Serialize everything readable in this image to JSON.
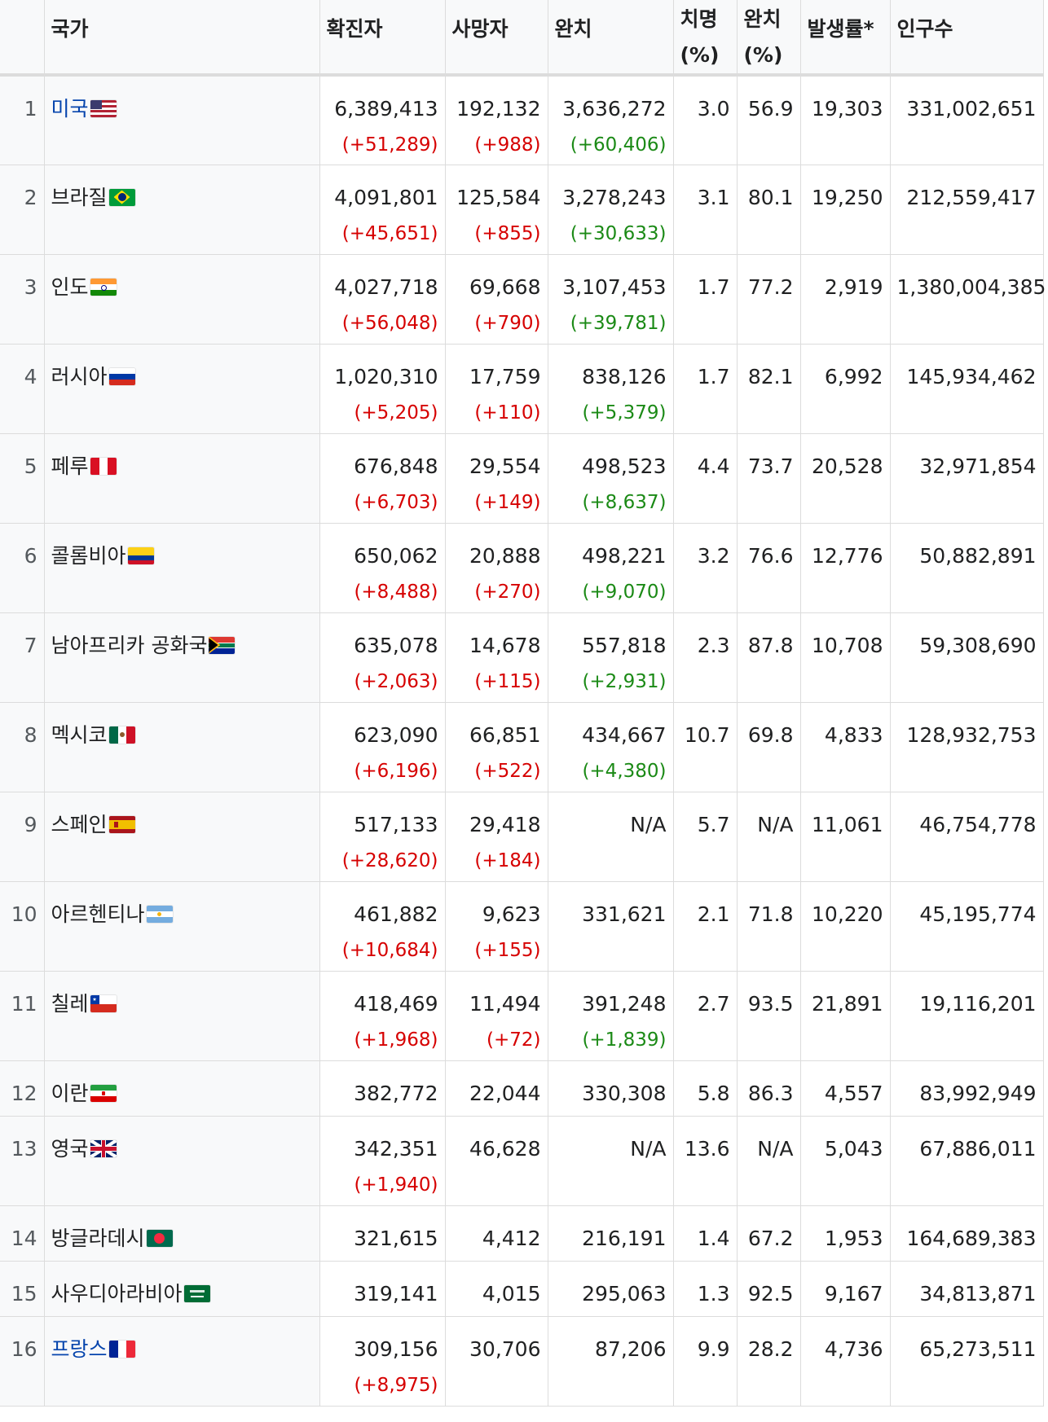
{
  "headers": {
    "country": "국가",
    "confirmed": "확진자",
    "deaths": "사망자",
    "recovered": "완치",
    "cfr_line1": "치명",
    "cfr_line2": "(%)",
    "rec_line1": "완치",
    "rec_line2": "(%)",
    "incidence": "발생률*",
    "population": "인구수"
  },
  "rows": [
    {
      "rank": "1",
      "country": "미국",
      "link": true,
      "flag": "us-flag",
      "confirmed": "6,389,413",
      "confirmed_delta": "(+51,289)",
      "deaths": "192,132",
      "deaths_delta": "(+988)",
      "recovered": "3,636,272",
      "recovered_delta": "(+60,406)",
      "cfr": "3.0",
      "rec_pct": "56.9",
      "incidence": "19,303",
      "population": "331,002,651"
    },
    {
      "rank": "2",
      "country": "브라질",
      "link": false,
      "flag": "br-flag",
      "confirmed": "4,091,801",
      "confirmed_delta": "(+45,651)",
      "deaths": "125,584",
      "deaths_delta": "(+855)",
      "recovered": "3,278,243",
      "recovered_delta": "(+30,633)",
      "cfr": "3.1",
      "rec_pct": "80.1",
      "incidence": "19,250",
      "population": "212,559,417"
    },
    {
      "rank": "3",
      "country": "인도",
      "link": false,
      "flag": "in-flag",
      "confirmed": "4,027,718",
      "confirmed_delta": "(+56,048)",
      "deaths": "69,668",
      "deaths_delta": "(+790)",
      "recovered": "3,107,453",
      "recovered_delta": "(+39,781)",
      "cfr": "1.7",
      "rec_pct": "77.2",
      "incidence": "2,919",
      "population": "1,380,004,385"
    },
    {
      "rank": "4",
      "country": "러시아",
      "link": false,
      "flag": "ru-flag",
      "confirmed": "1,020,310",
      "confirmed_delta": "(+5,205)",
      "deaths": "17,759",
      "deaths_delta": "(+110)",
      "recovered": "838,126",
      "recovered_delta": "(+5,379)",
      "cfr": "1.7",
      "rec_pct": "82.1",
      "incidence": "6,992",
      "population": "145,934,462"
    },
    {
      "rank": "5",
      "country": "페루",
      "link": false,
      "flag": "pe-flag",
      "confirmed": "676,848",
      "confirmed_delta": "(+6,703)",
      "deaths": "29,554",
      "deaths_delta": "(+149)",
      "recovered": "498,523",
      "recovered_delta": "(+8,637)",
      "cfr": "4.4",
      "rec_pct": "73.7",
      "incidence": "20,528",
      "population": "32,971,854"
    },
    {
      "rank": "6",
      "country": "콜롬비아",
      "link": false,
      "flag": "co-flag",
      "confirmed": "650,062",
      "confirmed_delta": "(+8,488)",
      "deaths": "20,888",
      "deaths_delta": "(+270)",
      "recovered": "498,221",
      "recovered_delta": "(+9,070)",
      "cfr": "3.2",
      "rec_pct": "76.6",
      "incidence": "12,776",
      "population": "50,882,891"
    },
    {
      "rank": "7",
      "country": "남아프리카 공화국",
      "link": false,
      "flag": "za-flag",
      "confirmed": "635,078",
      "confirmed_delta": "(+2,063)",
      "deaths": "14,678",
      "deaths_delta": "(+115)",
      "recovered": "557,818",
      "recovered_delta": "(+2,931)",
      "cfr": "2.3",
      "rec_pct": "87.8",
      "incidence": "10,708",
      "population": "59,308,690"
    },
    {
      "rank": "8",
      "country": "멕시코",
      "link": false,
      "flag": "mx-flag",
      "confirmed": "623,090",
      "confirmed_delta": "(+6,196)",
      "deaths": "66,851",
      "deaths_delta": "(+522)",
      "recovered": "434,667",
      "recovered_delta": "(+4,380)",
      "cfr": "10.7",
      "rec_pct": "69.8",
      "incidence": "4,833",
      "population": "128,932,753"
    },
    {
      "rank": "9",
      "country": "스페인",
      "link": false,
      "flag": "es-flag",
      "confirmed": "517,133",
      "confirmed_delta": "(+28,620)",
      "deaths": "29,418",
      "deaths_delta": "(+184)",
      "recovered": "N/A",
      "recovered_delta": "",
      "cfr": "5.7",
      "rec_pct": "N/A",
      "incidence": "11,061",
      "population": "46,754,778"
    },
    {
      "rank": "10",
      "country": "아르헨티나",
      "link": false,
      "flag": "ar-flag",
      "confirmed": "461,882",
      "confirmed_delta": "(+10,684)",
      "deaths": "9,623",
      "deaths_delta": "(+155)",
      "recovered": "331,621",
      "recovered_delta": "",
      "cfr": "2.1",
      "rec_pct": "71.8",
      "incidence": "10,220",
      "population": "45,195,774"
    },
    {
      "rank": "11",
      "country": "칠레",
      "link": false,
      "flag": "cl-flag",
      "confirmed": "418,469",
      "confirmed_delta": "(+1,968)",
      "deaths": "11,494",
      "deaths_delta": "(+72)",
      "recovered": "391,248",
      "recovered_delta": "(+1,839)",
      "cfr": "2.7",
      "rec_pct": "93.5",
      "incidence": "21,891",
      "population": "19,116,201"
    },
    {
      "rank": "12",
      "country": "이란",
      "link": false,
      "flag": "ir-flag",
      "confirmed": "382,772",
      "confirmed_delta": "",
      "deaths": "22,044",
      "deaths_delta": "",
      "recovered": "330,308",
      "recovered_delta": "",
      "cfr": "5.8",
      "rec_pct": "86.3",
      "incidence": "4,557",
      "population": "83,992,949"
    },
    {
      "rank": "13",
      "country": "영국",
      "link": false,
      "flag": "gb-flag",
      "confirmed": "342,351",
      "confirmed_delta": "(+1,940)",
      "deaths": "46,628",
      "deaths_delta": "",
      "recovered": "N/A",
      "recovered_delta": "",
      "cfr": "13.6",
      "rec_pct": "N/A",
      "incidence": "5,043",
      "population": "67,886,011"
    },
    {
      "rank": "14",
      "country": "방글라데시",
      "link": false,
      "flag": "bd-flag",
      "confirmed": "321,615",
      "confirmed_delta": "",
      "deaths": "4,412",
      "deaths_delta": "",
      "recovered": "216,191",
      "recovered_delta": "",
      "cfr": "1.4",
      "rec_pct": "67.2",
      "incidence": "1,953",
      "population": "164,689,383"
    },
    {
      "rank": "15",
      "country": "사우디아라비아",
      "link": false,
      "flag": "sa-flag",
      "confirmed": "319,141",
      "confirmed_delta": "",
      "deaths": "4,015",
      "deaths_delta": "",
      "recovered": "295,063",
      "recovered_delta": "",
      "cfr": "1.3",
      "rec_pct": "92.5",
      "incidence": "9,167",
      "population": "34,813,871"
    },
    {
      "rank": "16",
      "country": "프랑스",
      "link": true,
      "flag": "fr-flag",
      "confirmed": "309,156",
      "confirmed_delta": "(+8,975)",
      "deaths": "30,706",
      "deaths_delta": "",
      "recovered": "87,206",
      "recovered_delta": "",
      "cfr": "9.9",
      "rec_pct": "28.2",
      "incidence": "4,736",
      "population": "65,273,511"
    }
  ],
  "colors": {
    "link": "#0645ad",
    "increase": "#d60000",
    "recovered_increase": "#1b8a16",
    "header_bg": "#f8f9fa"
  }
}
